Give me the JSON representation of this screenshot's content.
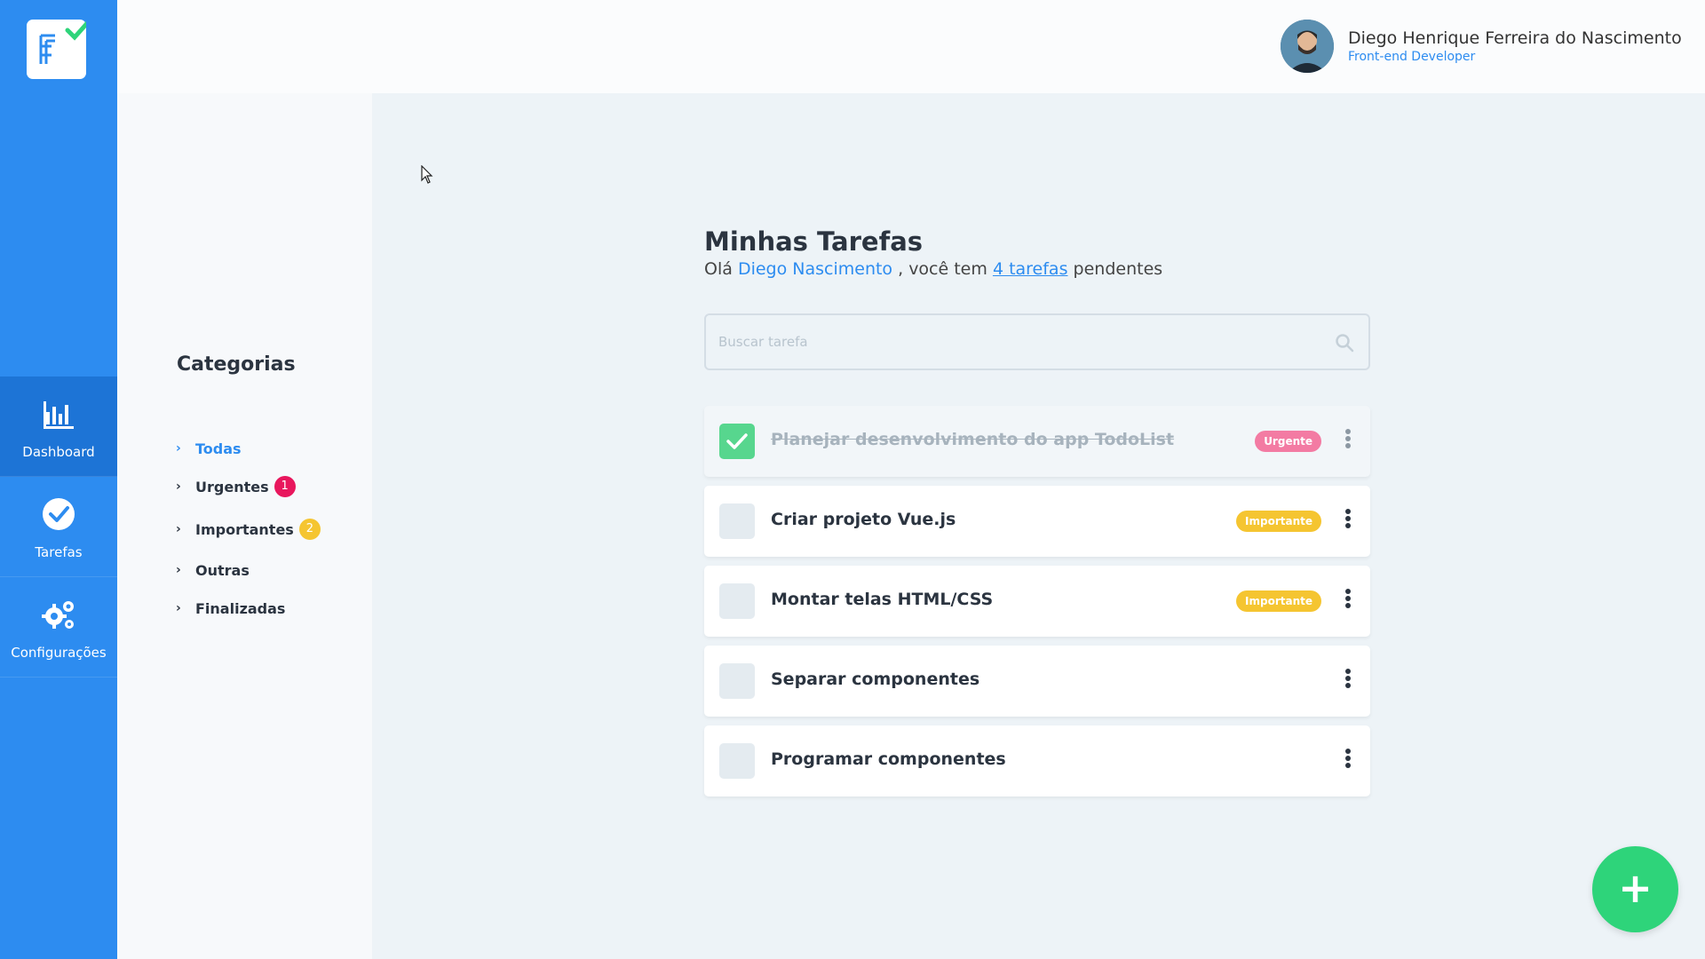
{
  "nav": {
    "items": [
      {
        "label": "Dashboard",
        "icon": "bar-chart-icon",
        "active": true
      },
      {
        "label": "Tarefas",
        "icon": "check-circle-icon",
        "active": false
      },
      {
        "label": "Configurações",
        "icon": "gears-icon",
        "active": false
      }
    ]
  },
  "header": {
    "user_name": "Diego Henrique Ferreira do Nascimento",
    "user_role": "Front-end Developer"
  },
  "categories": {
    "title": "Categorias",
    "items": [
      {
        "label": "Todas",
        "active": true
      },
      {
        "label": "Urgentes",
        "badge": "1",
        "badge_color": "#e8175d"
      },
      {
        "label": "Importantes",
        "badge": "2",
        "badge_color": "#f5c531"
      },
      {
        "label": "Outras"
      },
      {
        "label": "Finalizadas"
      }
    ]
  },
  "main": {
    "title": "Minhas Tarefas",
    "greeting_prefix": "Olá",
    "greeting_name": "Diego Nascimento",
    "greeting_mid": ", você tem",
    "greeting_link": "4 tarefas",
    "greeting_suffix": "pendentes"
  },
  "search": {
    "placeholder": "Buscar tarefa"
  },
  "tasks": [
    {
      "title": "Planejar desenvolvimento do app TodoList",
      "done": true,
      "tag": "Urgente"
    },
    {
      "title": "Criar projeto Vue.js",
      "done": false,
      "tag": "Importante"
    },
    {
      "title": "Montar telas HTML/CSS",
      "done": false,
      "tag": "Importante"
    },
    {
      "title": "Separar componentes",
      "done": false,
      "tag": ""
    },
    {
      "title": "Programar componentes",
      "done": false,
      "tag": ""
    }
  ],
  "colors": {
    "brand_blue": "#2d8cf0",
    "success_green": "#2ed47a",
    "urgent_pink": "#f37ba3",
    "important_yellow": "#f5c531"
  },
  "fab": {
    "label": "+"
  }
}
